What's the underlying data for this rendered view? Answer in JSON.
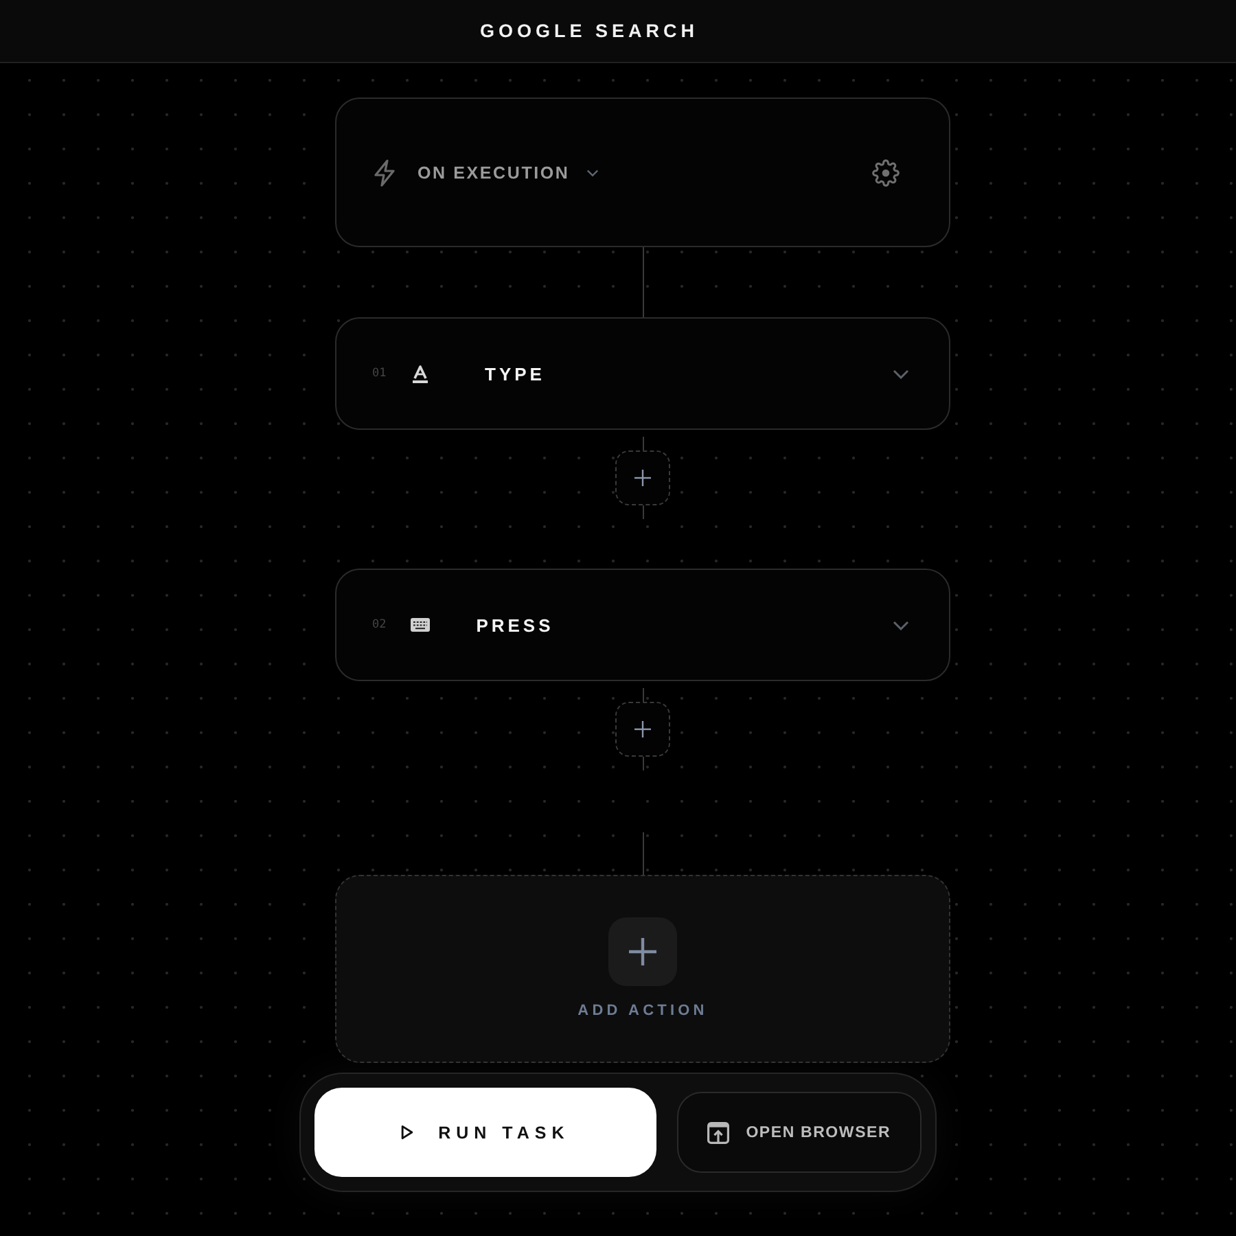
{
  "header": {
    "title": "GOOGLE SEARCH"
  },
  "trigger": {
    "label": "ON EXECUTION"
  },
  "steps": [
    {
      "number": "01",
      "label": "TYPE",
      "kind": "type"
    },
    {
      "number": "02",
      "label": "PRESS",
      "kind": "press"
    }
  ],
  "add_action": {
    "label": "ADD ACTION"
  },
  "footer": {
    "buttons": [
      {
        "label": "RUN TASK",
        "kind": "primary"
      },
      {
        "label": "OPEN BROWSER",
        "kind": "secondary"
      }
    ]
  }
}
